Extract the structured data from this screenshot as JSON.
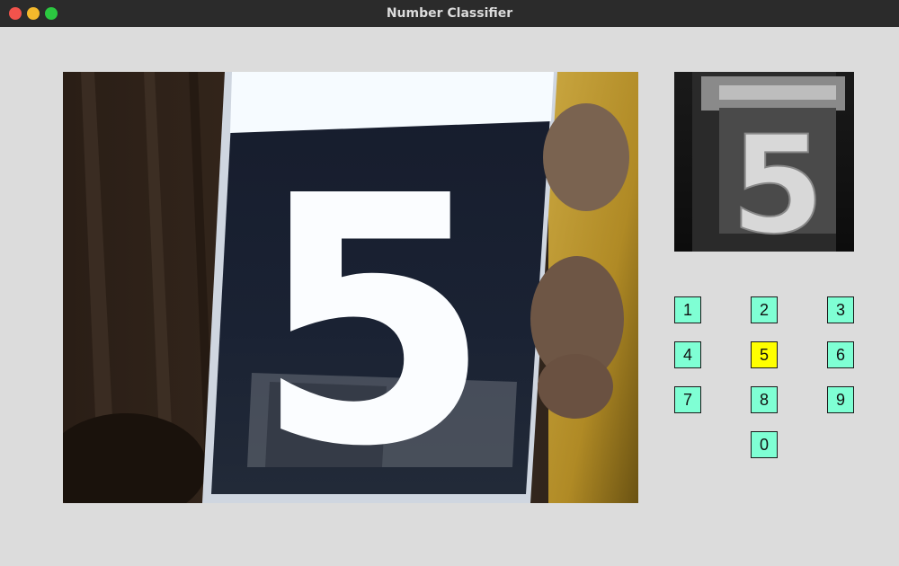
{
  "window": {
    "title": "Number Classifier"
  },
  "camera": {
    "displayed_digit": "5"
  },
  "thumbnail": {
    "digit": "5"
  },
  "keypad": {
    "keys": [
      "1",
      "2",
      "3",
      "4",
      "5",
      "6",
      "7",
      "8",
      "9",
      "0"
    ],
    "selected": "5",
    "colors": {
      "default": "#7fffd4",
      "selected": "#ffff00"
    }
  }
}
